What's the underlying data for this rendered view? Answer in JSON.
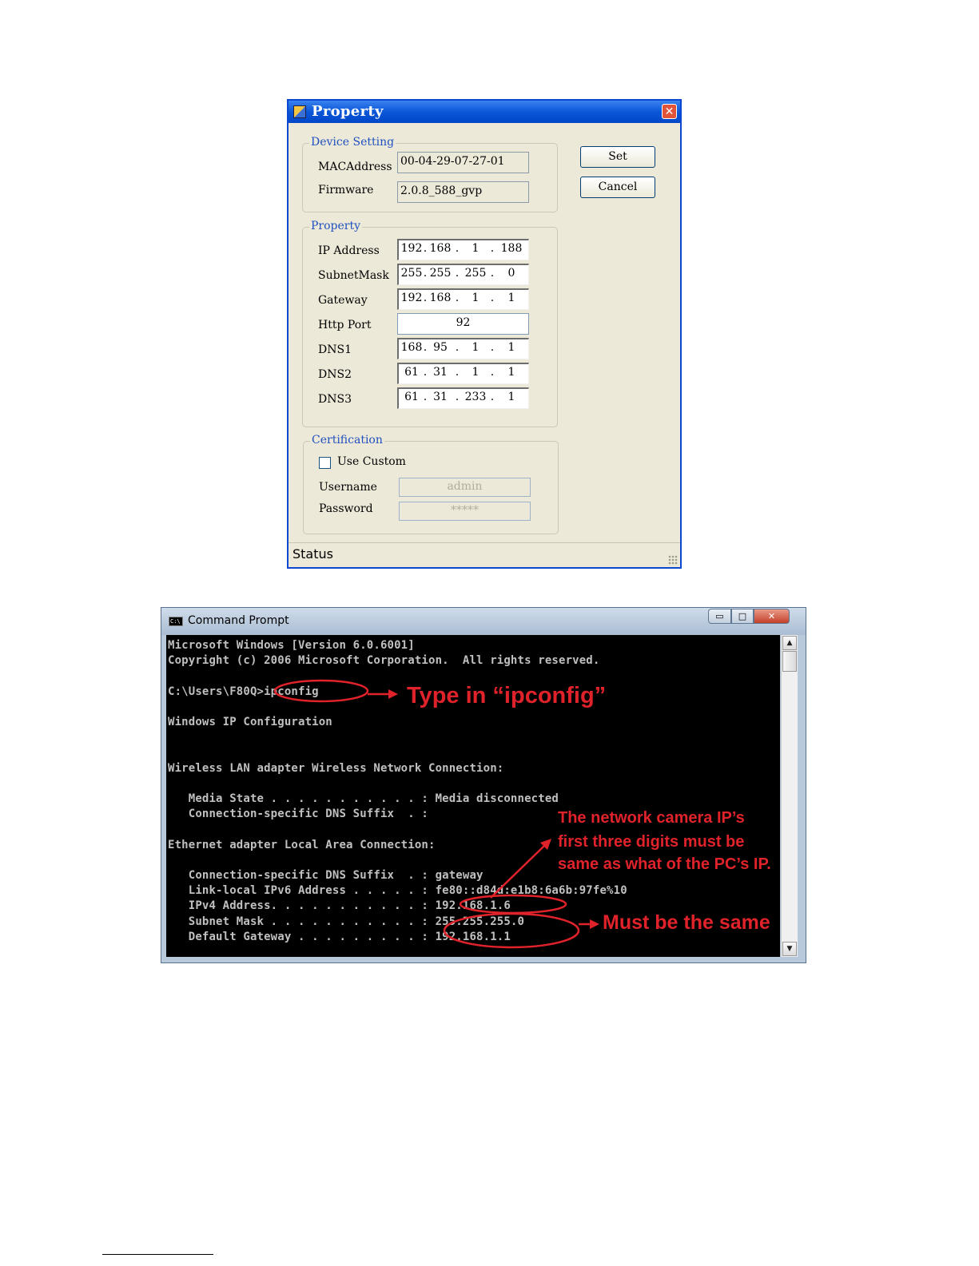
{
  "property_dialog": {
    "title": "Property",
    "close_glyph": "✕",
    "device_setting": {
      "legend": "Device Setting",
      "mac_label": "MACAddress",
      "mac_value": "00-04-29-07-27-01",
      "firmware_label": "Firmware",
      "firmware_value": "2.0.8_588_gvp"
    },
    "property": {
      "legend": "Property",
      "ip_label": "IP Address",
      "ip": [
        "192",
        "168",
        "1",
        "188"
      ],
      "subnet_label": "SubnetMask",
      "subnet": [
        "255",
        "255",
        "255",
        "0"
      ],
      "gateway_label": "Gateway",
      "gateway": [
        "192",
        "168",
        "1",
        "1"
      ],
      "http_port_label": "Http Port",
      "http_port": "92",
      "dns1_label": "DNS1",
      "dns1": [
        "168",
        "95",
        "1",
        "1"
      ],
      "dns2_label": "DNS2",
      "dns2": [
        "61",
        "31",
        "1",
        "1"
      ],
      "dns3_label": "DNS3",
      "dns3": [
        "61",
        "31",
        "233",
        "1"
      ]
    },
    "certification": {
      "legend": "Certification",
      "use_custom_label": "Use Custom",
      "use_custom_checked": false,
      "username_label": "Username",
      "username_value": "admin",
      "password_label": "Password",
      "password_value": "*****"
    },
    "set_label": "Set",
    "cancel_label": "Cancel",
    "status": "Status"
  },
  "command_prompt": {
    "title": "Command Prompt",
    "icon_text": "C:\\",
    "min_glyph": "▭",
    "max_glyph": "□",
    "close_glyph": "✕",
    "scroll_up_glyph": "▲",
    "scroll_down_glyph": "▼",
    "lines": [
      "Microsoft Windows [Version 6.0.6001]",
      "Copyright (c) 2006 Microsoft Corporation.  All rights reserved.",
      "",
      "C:\\Users\\F80Q>ipconfig",
      "",
      "Windows IP Configuration",
      "",
      "",
      "Wireless LAN adapter Wireless Network Connection:",
      "",
      "   Media State . . . . . . . . . . . : Media disconnected",
      "   Connection-specific DNS Suffix  . :",
      "",
      "Ethernet adapter Local Area Connection:",
      "",
      "   Connection-specific DNS Suffix  . : gateway",
      "   Link-local IPv6 Address . . . . . : fe80::d84d:e1b8:6a6b:97fe%10",
      "   IPv4 Address. . . . . . . . . . . : 192.168.1.6",
      "   Subnet Mask . . . . . . . . . . . : 255.255.255.0",
      "   Default Gateway . . . . . . . . . : 192.168.1.1"
    ],
    "annotations": {
      "type_in": "Type in “ipconfig”",
      "camera_ip_line1": "The network camera IP’s",
      "camera_ip_line2": "first three digits must be",
      "camera_ip_line3": "same as what of the PC’s IP.",
      "must_be_same": "Must be the same",
      "color": "#e0222a"
    }
  }
}
